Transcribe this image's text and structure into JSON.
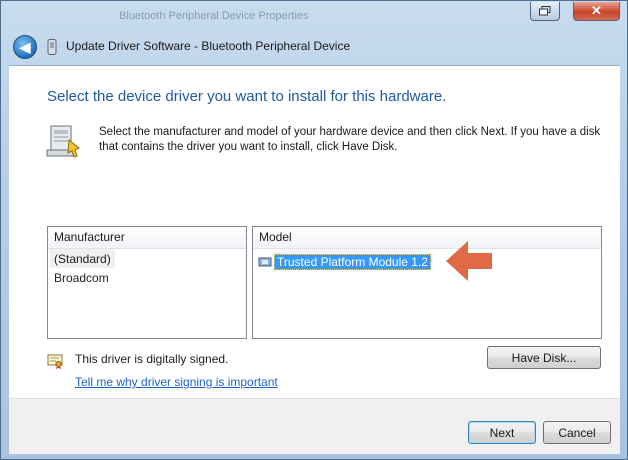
{
  "window": {
    "background_title": "Bluetooth Peripheral Device Properties",
    "close_glyph": "✕"
  },
  "header": {
    "back_glyph": "◀",
    "title": "Update Driver Software - Bluetooth Peripheral Device"
  },
  "main": {
    "heading": "Select the device driver you want to install for this hardware.",
    "description": "Select the manufacturer and model of your hardware device and then click Next. If you have a disk that contains the driver you want to install, click Have Disk."
  },
  "manufacturer_list": {
    "header": "Manufacturer",
    "items": [
      "(Standard)",
      "Broadcom"
    ],
    "selected": "(Standard)"
  },
  "model_list": {
    "header": "Model",
    "items": [
      "Trusted Platform Module 1.2"
    ],
    "selected": "Trusted Platform Module 1.2"
  },
  "signing": {
    "status": "This driver is digitally signed.",
    "link": "Tell me why driver signing is important"
  },
  "buttons": {
    "have_disk": "Have Disk...",
    "next": "Next",
    "cancel": "Cancel"
  },
  "colors": {
    "heading": "#1f5aa6",
    "selection": "#3399ff",
    "annotation_arrow": "#e06a45",
    "link": "#1e64c8"
  },
  "icons": {
    "back": "back-arrow-icon",
    "device": "bluetooth-device-icon",
    "hardware": "hardware-install-icon",
    "model": "tpm-chip-icon",
    "signed": "signed-certificate-icon",
    "annotation": "pointer-arrow-icon"
  }
}
